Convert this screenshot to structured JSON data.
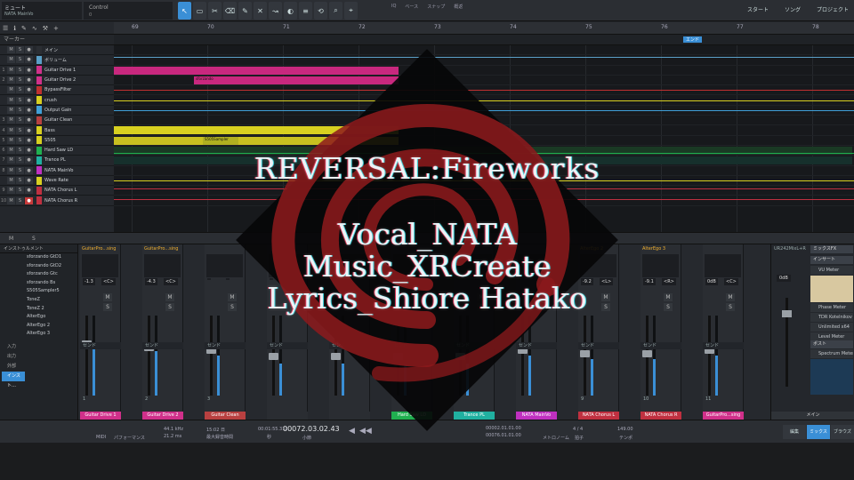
{
  "toolbar": {
    "song_mode": "ミュート",
    "song_name": "NATA MainVo",
    "control_label": "Control",
    "control_value": "0",
    "quantize_label": "IQ",
    "quantize_1": "ベース",
    "quantize_2": "スナップ",
    "snap_value": "概返",
    "nav": [
      "スタート",
      "ソング",
      "プロジェクト"
    ]
  },
  "ruler": {
    "bars": [
      "69",
      "70",
      "71",
      "72",
      "73",
      "74",
      "75",
      "76",
      "77",
      "78"
    ],
    "end_marker": "エンド"
  },
  "markers_label": "マーカー",
  "tracks": [
    {
      "num": "",
      "name": "メイン",
      "color": "#2b2e33",
      "rec": false
    },
    {
      "num": "",
      "name": "ボリューム",
      "color": "#5aa0c8",
      "rec": false
    },
    {
      "num": "1",
      "name": "Guitar Drive 1",
      "color": "#d0308a",
      "rec": false
    },
    {
      "num": "2",
      "name": "Guitar Drive 2",
      "color": "#d0308a",
      "rec": false
    },
    {
      "num": "",
      "name": "BypassFilter",
      "color": "#c03030",
      "rec": false
    },
    {
      "num": "",
      "name": "crush",
      "color": "#d8d020",
      "rec": false
    },
    {
      "num": "",
      "name": "Output Gain",
      "color": "#40a0d8",
      "rec": false
    },
    {
      "num": "3",
      "name": "Guitar Clean",
      "color": "#b84040",
      "rec": false
    },
    {
      "num": "4",
      "name": "Bass",
      "color": "#d8d020",
      "rec": false
    },
    {
      "num": "5",
      "name": "S505",
      "color": "#d8d020",
      "rec": false
    },
    {
      "num": "6",
      "name": "Hard Saw LD",
      "color": "#20b050",
      "rec": false
    },
    {
      "num": "7",
      "name": "Trance PL",
      "color": "#20b0a0",
      "rec": false
    },
    {
      "num": "8",
      "name": "NATA MainVo",
      "color": "#c030c0",
      "rec": false
    },
    {
      "num": "",
      "name": "Wave Rate",
      "color": "#d8d020",
      "rec": false
    },
    {
      "num": "9",
      "name": "NATA Chorus L",
      "color": "#c03040",
      "rec": false
    },
    {
      "num": "10",
      "name": "NATA Chorus R",
      "color": "#c03040",
      "rec": true
    }
  ],
  "clip_labels": {
    "guitar2": "sforzando",
    "s505a": "sforzando",
    "s505b": "S505Sampler"
  },
  "split_bar": {
    "m": "M",
    "s": "S"
  },
  "mixer": {
    "browser_title": "インストゥルメント",
    "instruments": [
      "sforzando GtD1",
      "sforzando GtD2",
      "sforzando Gtc",
      "sforzando Bs",
      "S505Sampler5",
      "TonеZ",
      "TonеZ 2",
      "AlterEgo",
      "AlterEgo 2",
      "AlterEgo 3"
    ],
    "side": [
      "入力",
      "出力",
      "外部",
      "インスト…"
    ],
    "strips": [
      {
        "top": "GuitarPro...sing",
        "db": "-1.3",
        "pan": "<C>",
        "name": "Guitar Drive 1",
        "color": "#d0308a",
        "ch": "1",
        "level": 0.6
      },
      {
        "top": "GuitarPro...sing",
        "db": "-4.3",
        "pan": "<C>",
        "name": "Guitar Drive 2",
        "color": "#d0308a",
        "ch": "2",
        "level": 0.55
      },
      {
        "top": "",
        "db": "",
        "pan": "",
        "name": "Guitar Clean",
        "color": "#b84040",
        "ch": "3",
        "level": 0.5
      },
      {
        "top": "",
        "db": "",
        "pan": "",
        "name": "",
        "color": "#2a2d32",
        "ch": "",
        "level": 0.4
      },
      {
        "top": "",
        "db": "",
        "pan": "",
        "name": "",
        "color": "#2a2d32",
        "ch": "",
        "level": 0.4
      },
      {
        "top": "",
        "db": "",
        "pan": "",
        "name": "Hard Saw LD",
        "color": "#20b050",
        "ch": "",
        "level": 0.4
      },
      {
        "top": "",
        "db": "",
        "pan": "",
        "name": "Trance PL",
        "color": "#20b0a0",
        "ch": "",
        "level": 0.4
      },
      {
        "top": "",
        "db": "",
        "pan": "",
        "name": "NATA MainVo",
        "color": "#c030c0",
        "ch": "",
        "level": 0.5
      },
      {
        "top": "AlterEgo 2",
        "db": "-9.2",
        "pan": "<L>",
        "name": "NATA Chorus L",
        "color": "#c03040",
        "ch": "9",
        "level": 0.45
      },
      {
        "top": "AlterEgo 3",
        "db": "-9.1",
        "pan": "<R>",
        "name": "NATA Chorus R",
        "color": "#c03040",
        "ch": "10",
        "level": 0.45
      },
      {
        "top": "",
        "db": "0dB",
        "pan": "<C>",
        "name": "GuitarPro...sing",
        "color": "#d0308a",
        "ch": "11",
        "level": 0.5
      }
    ],
    "send_label": "センド",
    "fx": {
      "output_title": "UR242MixL+R",
      "fx_title": "ミックスFX",
      "insert_label": "インサート",
      "post_label": "ポスト",
      "db": "0dB",
      "inserts": [
        "VU Meter",
        "Phase Meter",
        "TDR Kotelnikov",
        "Unlimited x64",
        "Level Meter"
      ],
      "posts": [
        "Spectrum Meter"
      ],
      "main_label": "メイン"
    }
  },
  "transport": {
    "midi": "MIDI",
    "perf": "パフォーマンス",
    "rate": "44.1 kHz",
    "latency": "21.2 ms",
    "rec_time": "15:02 日",
    "rec_label": "最大録音時間",
    "time": "00:01:55.312",
    "time_unit": "秒",
    "bars": "00072.03.02.43",
    "bars_unit": "小節",
    "loop_l": "00002.01.01.00",
    "loop_r": "00076.01.01.00",
    "meter": "4 / 4",
    "tempo": "149.00",
    "metro_label": "メトロノーム",
    "sig_label": "拍子",
    "tempo_label": "テンポ",
    "tabs": [
      "編集",
      "ミックス",
      "ブラウズ"
    ]
  },
  "overlay": {
    "title": "REVERSAL:Fireworks",
    "credits": [
      "Vocal_NATA",
      "Music_XRCreate",
      "Lyrics_Shiore Hatako"
    ]
  }
}
